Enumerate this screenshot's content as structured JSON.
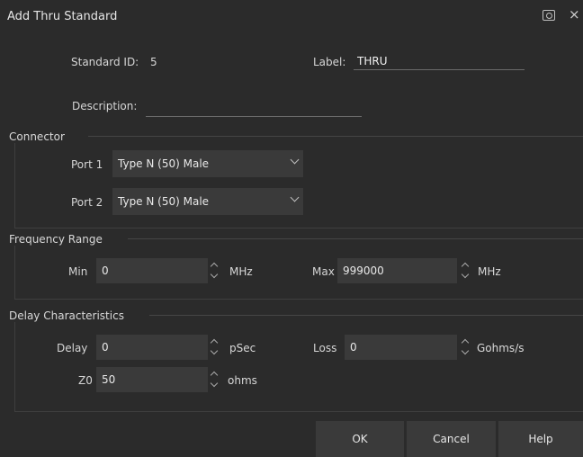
{
  "dialog": {
    "title": "Add Thru Standard",
    "icons": {
      "screenshot": "camera-icon",
      "close": "close-icon"
    }
  },
  "header": {
    "standard_id_label": "Standard ID:",
    "standard_id_value": "5",
    "label_label": "Label:",
    "label_value": "THRU",
    "description_label": "Description:",
    "description_value": ""
  },
  "connector": {
    "title": "Connector",
    "ports": [
      {
        "label": "Port 1",
        "value": "Type N (50) Male"
      },
      {
        "label": "Port 2",
        "value": "Type N (50) Male"
      }
    ]
  },
  "frequency": {
    "title": "Frequency Range",
    "min_label": "Min",
    "min_value": "0",
    "min_unit": "MHz",
    "max_label": "Max",
    "max_value": "999000",
    "max_unit": "MHz"
  },
  "delay": {
    "title": "Delay Characteristics",
    "delay_label": "Delay",
    "delay_value": "0",
    "delay_unit": "pSec",
    "loss_label": "Loss",
    "loss_value": "0",
    "loss_unit": "Gohms/s",
    "z0_label": "Z0",
    "z0_value": "50",
    "z0_unit": "ohms"
  },
  "buttons": {
    "ok": "OK",
    "cancel": "Cancel",
    "help": "Help"
  },
  "colors": {
    "background": "#2b2b2b",
    "field": "#3a3a3a",
    "text": "#d8d8d8"
  }
}
